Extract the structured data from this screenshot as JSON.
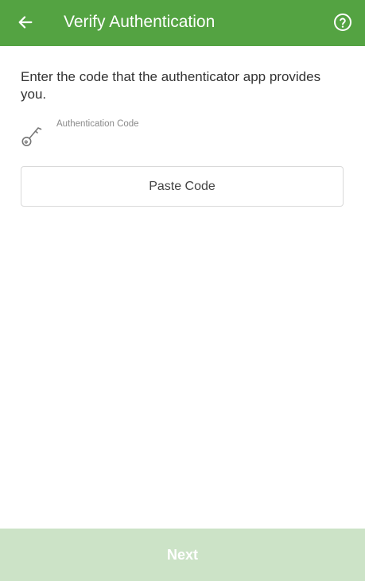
{
  "header": {
    "title": "Verify Authentication",
    "back_icon": "arrow-left-icon",
    "help_icon": "question-circle-icon"
  },
  "instructions": "Enter the code that the authenticator app provides you.",
  "code_field": {
    "label": "Authentication Code",
    "value": "",
    "icon": "key-icon"
  },
  "paste_button": {
    "label": "Paste Code"
  },
  "next_button": {
    "label": "Next",
    "enabled": false
  },
  "colors": {
    "header_bg": "#54a342",
    "next_disabled_bg": "#cce3c7"
  }
}
